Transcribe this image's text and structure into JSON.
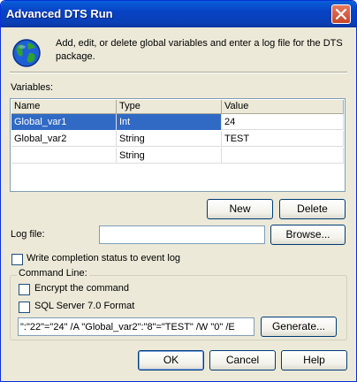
{
  "window": {
    "title": "Advanced DTS Run",
    "close_glyph": "✕"
  },
  "description": "Add, edit, or delete global variables and enter a log file for the DTS package.",
  "variables": {
    "label": "Variables:",
    "columns": [
      "Name",
      "Type",
      "Value"
    ],
    "rows": [
      {
        "name": "Global_var1",
        "type": "Int",
        "value": "24",
        "selected": true
      },
      {
        "name": "Global_var2",
        "type": "String",
        "value": "TEST",
        "selected": false
      },
      {
        "name": "",
        "type": "String",
        "value": "",
        "selected": false
      }
    ]
  },
  "buttons": {
    "new": "New",
    "delete": "Delete",
    "browse": "Browse...",
    "generate": "Generate...",
    "ok": "OK",
    "cancel": "Cancel",
    "help": "Help"
  },
  "log_file": {
    "label": "Log file:",
    "value": ""
  },
  "write_status": {
    "label": "Write completion status to event log",
    "checked": false
  },
  "command_line": {
    "title": "Command Line:",
    "encrypt": {
      "label": "Encrypt the command",
      "checked": false
    },
    "sql7": {
      "label": "SQL Server 7.0 Format",
      "checked": false
    },
    "value": "\":\"22\"=\"24\" /A \"Global_var2\":\"8\"=\"TEST\" /W \"0\" /E"
  },
  "colors": {
    "titlebar": "#0a4fd0",
    "face": "#ece9d8",
    "selection": "#316ac5",
    "close": "#d8593a"
  }
}
